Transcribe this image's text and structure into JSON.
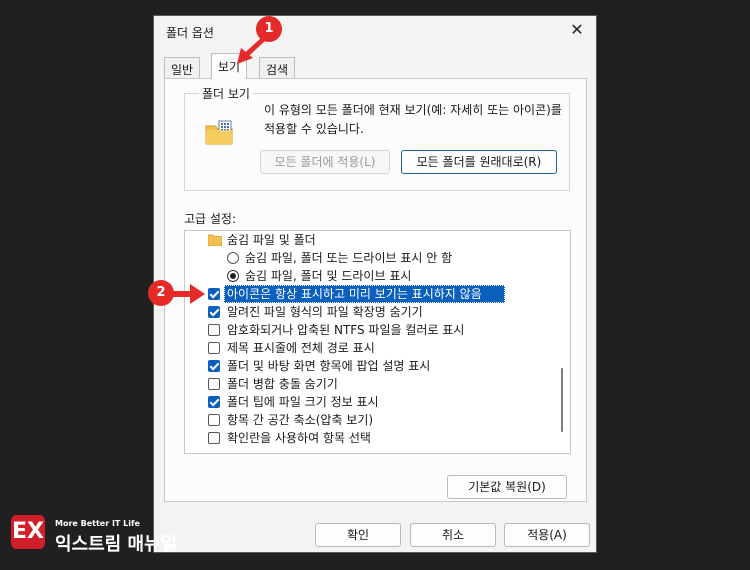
{
  "dialog": {
    "title": "폴더 옵션",
    "close": "✕"
  },
  "tabs": [
    {
      "label": "일반"
    },
    {
      "label": "보기"
    },
    {
      "label": "검색"
    }
  ],
  "folder_view": {
    "group_label": "폴더 보기",
    "description": "이 유형의 모든 폴더에 현재 보기(예: 자세히 또는 아이콘)를 적용할 수 있습니다.",
    "apply_button": "모든 폴더에 적용(L)",
    "reset_button": "모든 폴더를 원래대로(R)"
  },
  "advanced": {
    "label": "고급 설정:",
    "items": [
      {
        "type": "folder",
        "label": "숨김 파일 및 폴더"
      },
      {
        "type": "radio",
        "checked": false,
        "label": "숨김 파일, 폴더 또는 드라이브 표시 안 함"
      },
      {
        "type": "radio",
        "checked": true,
        "label": "숨김 파일, 폴더 및 드라이브 표시"
      },
      {
        "type": "checkbox",
        "checked": true,
        "selected": true,
        "label": "아이콘은 항상 표시하고 미리 보기는 표시하지 않음"
      },
      {
        "type": "checkbox",
        "checked": true,
        "label": "알려진 파일 형식의 파일 확장명 숨기기"
      },
      {
        "type": "checkbox",
        "checked": false,
        "label": "암호화되거나 압축된 NTFS 파일을 컬러로 표시"
      },
      {
        "type": "checkbox",
        "checked": false,
        "label": "제목 표시줄에 전체 경로 표시"
      },
      {
        "type": "checkbox",
        "checked": true,
        "label": "폴더 및 바탕 화면 항목에 팝업 설명 표시"
      },
      {
        "type": "checkbox",
        "checked": false,
        "label": "폴더 병합 충돌 숨기기"
      },
      {
        "type": "checkbox",
        "checked": true,
        "label": "폴더 팁에 파일 크기 정보 표시"
      },
      {
        "type": "checkbox",
        "checked": false,
        "label": "항목 간 공간 축소(압축 보기)"
      },
      {
        "type": "checkbox",
        "checked": false,
        "label": "확인란을 사용하여 항목 선택"
      }
    ],
    "restore_button": "기본값 복원(D)"
  },
  "footer": {
    "ok": "확인",
    "cancel": "취소",
    "apply": "적용(A)"
  },
  "markers": {
    "one": "1",
    "two": "2"
  },
  "watermark": {
    "icon": "EX",
    "tagline": "More Better IT Life",
    "name": "익스트림 매뉴얼"
  },
  "colors": {
    "accent": "#0b5fbd",
    "marker": "#e52a2a",
    "brand": "#d11f2a"
  }
}
